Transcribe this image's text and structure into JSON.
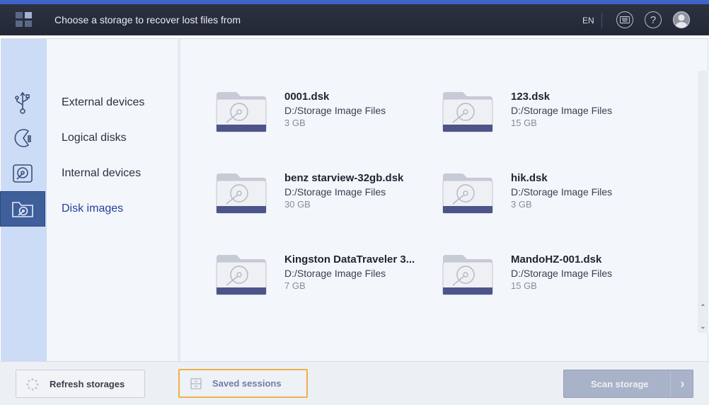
{
  "header": {
    "title": "Choose a storage to recover lost files from",
    "language": "EN",
    "help_symbol": "?",
    "icons": [
      "app-logo-icon",
      "keyboard-icon",
      "help-icon",
      "user-avatar-icon"
    ]
  },
  "sidebar": {
    "items": [
      {
        "label": "External devices",
        "icon": "usb-icon",
        "active": false
      },
      {
        "label": "Logical disks",
        "icon": "pie-disk-icon",
        "active": false
      },
      {
        "label": "Internal devices",
        "icon": "hard-drive-icon",
        "active": false
      },
      {
        "label": "Disk images",
        "icon": "disk-image-folder-icon",
        "active": true
      }
    ]
  },
  "storages": [
    {
      "name": "0001.dsk",
      "path": "D:/Storage Image Files",
      "size": "3 GB"
    },
    {
      "name": "123.dsk",
      "path": "D:/Storage Image Files",
      "size": "15 GB"
    },
    {
      "name": "benz starview-32gb.dsk",
      "path": "D:/Storage Image Files",
      "size": "30 GB"
    },
    {
      "name": "hik.dsk",
      "path": "D:/Storage Image Files",
      "size": "3 GB"
    },
    {
      "name": "Kingston DataTraveler 3...",
      "path": "D:/Storage Image Files",
      "size": "7 GB"
    },
    {
      "name": "MandoHZ-001.dsk",
      "path": "D:/Storage Image Files",
      "size": "15 GB"
    }
  ],
  "footer": {
    "refresh_label": "Refresh storages",
    "saved_label": "Saved sessions",
    "scan_label": "Scan storage"
  },
  "colors": {
    "header_bg": "#262a38",
    "accent": "#3e63c9",
    "rail_bg": "#ccdcf7",
    "active_item": "#3f5f9a",
    "focus_outline": "#f0b04a",
    "scan_disabled": "#a8b2c8"
  }
}
